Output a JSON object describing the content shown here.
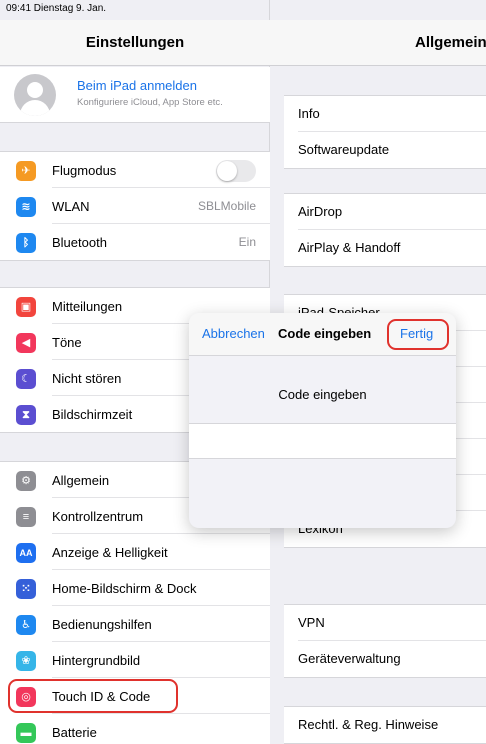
{
  "status_bar": {
    "time_date": "09:41  Dienstag 9. Jan."
  },
  "sidebar": {
    "title": "Einstellungen",
    "profile": {
      "title": "Beim iPad anmelden",
      "subtitle": "Konfiguriere iCloud, App Store etc."
    },
    "group1": [
      {
        "label": "Flugmodus",
        "icon": "airplane-icon",
        "color": "#f59a23",
        "toggle": false
      },
      {
        "label": "WLAN",
        "value": "SBLMobile",
        "icon": "wifi-icon",
        "color": "#1e88f0"
      },
      {
        "label": "Bluetooth",
        "value": "Ein",
        "icon": "bluetooth-icon",
        "color": "#1e88f0"
      }
    ],
    "group2": [
      {
        "label": "Mitteilungen",
        "icon": "notifications-icon",
        "color": "#f2453d"
      },
      {
        "label": "Töne",
        "icon": "sounds-icon",
        "color": "#f2375c"
      },
      {
        "label": "Nicht stören",
        "icon": "moon-icon",
        "color": "#5b4ed1"
      },
      {
        "label": "Bildschirmzeit",
        "icon": "hourglass-icon",
        "color": "#5b4ed1"
      }
    ],
    "group3": [
      {
        "label": "Allgemein",
        "icon": "gear-icon",
        "color": "#8e8e93"
      },
      {
        "label": "Kontrollzentrum",
        "icon": "control-center-icon",
        "color": "#8e8e93"
      },
      {
        "label": "Anzeige & Helligkeit",
        "icon": "display-icon",
        "color": "#1e6ff0"
      },
      {
        "label": "Home-Bildschirm & Dock",
        "icon": "home-screen-icon",
        "color": "#3560d9"
      },
      {
        "label": "Bedienungshilfen",
        "icon": "accessibility-icon",
        "color": "#1e88f0"
      },
      {
        "label": "Hintergrundbild",
        "icon": "wallpaper-icon",
        "color": "#35b5e8"
      },
      {
        "label": "Touch ID & Code",
        "icon": "fingerprint-icon",
        "color": "#f2375c"
      },
      {
        "label": "Batterie",
        "icon": "battery-icon",
        "color": "#34c759"
      }
    ]
  },
  "main": {
    "title": "Allgemein",
    "group1": [
      "Info",
      "Softwareupdate"
    ],
    "group2": [
      "AirDrop",
      "AirPlay & Handoff"
    ],
    "group3": [
      "iPad-Speicher",
      "",
      "",
      "",
      "",
      "",
      "Lexikon"
    ],
    "group4": [
      "VPN",
      "Geräteverwaltung"
    ],
    "group5": [
      "Rechtl. & Reg. Hinweise"
    ]
  },
  "popover": {
    "cancel_label": "Abbrechen",
    "title": "Code eingeben",
    "done_label": "Fertig",
    "prompt": "Code eingeben"
  }
}
